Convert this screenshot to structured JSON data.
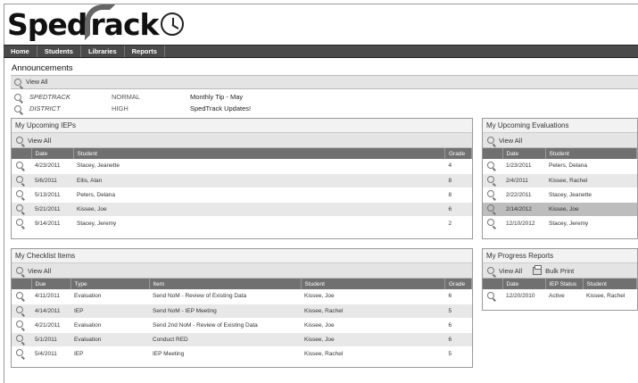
{
  "logo": {
    "part1": "Sped",
    "part2": "rack"
  },
  "nav": [
    "Home",
    "Students",
    "Libraries",
    "Reports"
  ],
  "announcements": {
    "title": "Announcements",
    "view_all": "View All",
    "rows": [
      {
        "source": "SPEDTRACK",
        "priority": "NORMAL",
        "message": "Monthly Tip - May"
      },
      {
        "source": "DISTRICT",
        "priority": "HIGH",
        "message": "SpedTrack Updates!"
      }
    ]
  },
  "ieps": {
    "title": "My Upcoming IEPs",
    "view_all": "View All",
    "columns": [
      "Date",
      "Student",
      "Grade"
    ],
    "rows": [
      {
        "date": "4/23/2011",
        "student": "Stacey, Jeanette",
        "grade": "4"
      },
      {
        "date": "5/6/2011",
        "student": "Ellis, Alan",
        "grade": "8"
      },
      {
        "date": "5/13/2011",
        "student": "Peters, Delana",
        "grade": "8"
      },
      {
        "date": "5/21/2011",
        "student": "Kissee, Joe",
        "grade": "6"
      },
      {
        "date": "9/14/2011",
        "student": "Stacey, Jeremy",
        "grade": "2"
      }
    ]
  },
  "evaluations": {
    "title": "My Upcoming Evaluations",
    "view_all": "View All",
    "columns": [
      "Date",
      "Student"
    ],
    "rows": [
      {
        "date": "1/23/2011",
        "student": "Peters, Delana"
      },
      {
        "date": "2/4/2011",
        "student": "Kissee, Rachel"
      },
      {
        "date": "2/22/2011",
        "student": "Stacey, Jeanette"
      },
      {
        "date": "2/14/2012",
        "student": "Kissee, Joe"
      },
      {
        "date": "12/10/2012",
        "student": "Stacey, Jeremy"
      }
    ]
  },
  "checklist": {
    "title": "My Checklist Items",
    "view_all": "View All",
    "columns": [
      "Due",
      "Type",
      "Item",
      "Student",
      "Grade"
    ],
    "rows": [
      {
        "due": "4/11/2011",
        "type": "Evaluation",
        "item": "Send NoM - Review of Existing Data",
        "student": "Kissee, Joe",
        "grade": "6"
      },
      {
        "due": "4/14/2011",
        "type": "IEP",
        "item": "Send NoM - IEP Meeting",
        "student": "Kissee, Rachel",
        "grade": "5"
      },
      {
        "due": "4/21/2011",
        "type": "Evaluation",
        "item": "Send 2nd NoM - Review of Existing Data",
        "student": "Kissee, Joe",
        "grade": "6"
      },
      {
        "due": "5/1/2011",
        "type": "Evaluation",
        "item": "Conduct RED",
        "student": "Kissee, Joe",
        "grade": "6"
      },
      {
        "due": "5/4/2011",
        "type": "IEP",
        "item": "IEP Meeting",
        "student": "Kissee, Rachel",
        "grade": "5"
      }
    ]
  },
  "progress": {
    "title": "My Progress Reports",
    "view_all": "View All",
    "bulk_print": "Bulk Print",
    "columns": [
      "Date",
      "IEP Status",
      "Student"
    ],
    "rows": [
      {
        "date": "12/20/2010",
        "status": "Active",
        "student": "Kissee, Rachel"
      }
    ]
  }
}
